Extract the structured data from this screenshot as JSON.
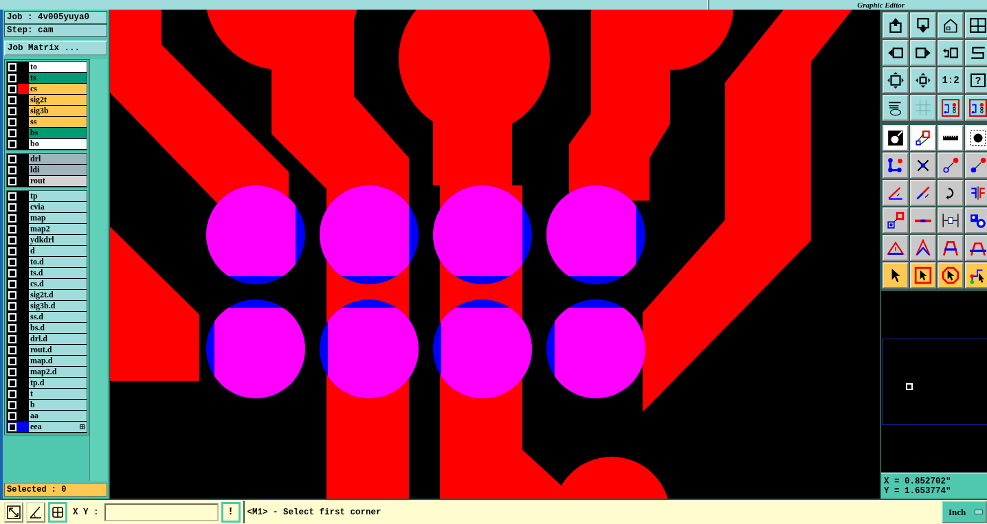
{
  "window": {
    "title": "Graphic Editor"
  },
  "job": {
    "label": "Job : 4v005yuya0",
    "step": "Step: cam",
    "matrix_button": "Job Matrix ..."
  },
  "layer_groups": [
    {
      "layers": [
        {
          "name": "to",
          "color": "#ffffff",
          "selected": false
        },
        {
          "name": "ts",
          "color": "#009a74",
          "selected": false
        },
        {
          "name": "cs",
          "color": "#ffc850",
          "selected": false,
          "swatch": {
            "color": "#ff0000"
          }
        },
        {
          "name": "sig2t",
          "color": "#ffc850",
          "selected": false
        },
        {
          "name": "sig3b",
          "color": "#ffc850",
          "selected": false
        },
        {
          "name": "ss",
          "color": "#ffc850",
          "selected": false
        },
        {
          "name": "bs",
          "color": "#009a74",
          "selected": false
        },
        {
          "name": "bo",
          "color": "#ffffff",
          "selected": false
        }
      ]
    },
    {
      "layers": [
        {
          "name": "drl",
          "color": "#a0b4bc",
          "selected": false
        },
        {
          "name": "ldi",
          "color": "#a0b4bc",
          "selected": false
        },
        {
          "name": "rout",
          "color": "#d4d4d4",
          "selected": false
        }
      ]
    },
    {
      "layers": [
        {
          "name": "tp",
          "color": "#a0dcdc",
          "selected": false
        },
        {
          "name": "cvia",
          "color": "#a0dcdc",
          "selected": false
        },
        {
          "name": "map",
          "color": "#a0dcdc",
          "selected": false
        },
        {
          "name": "map2",
          "color": "#a0dcdc",
          "selected": false
        },
        {
          "name": "ydkdrl",
          "color": "#a0dcdc",
          "selected": false
        },
        {
          "name": "d",
          "color": "#a0dcdc",
          "selected": false
        },
        {
          "name": "to.d",
          "color": "#a0dcdc",
          "selected": false
        },
        {
          "name": "ts.d",
          "color": "#a0dcdc",
          "selected": false
        },
        {
          "name": "cs.d",
          "color": "#a0dcdc",
          "selected": false
        },
        {
          "name": "sig2t.d",
          "color": "#a0dcdc",
          "selected": false
        },
        {
          "name": "sig3b.d",
          "color": "#a0dcdc",
          "selected": false
        },
        {
          "name": "ss.d",
          "color": "#a0dcdc",
          "selected": false
        },
        {
          "name": "bs.d",
          "color": "#a0dcdc",
          "selected": false
        },
        {
          "name": "drl.d",
          "color": "#a0dcdc",
          "selected": false
        },
        {
          "name": "rout.d",
          "color": "#a0dcdc",
          "selected": false
        },
        {
          "name": "map.d",
          "color": "#a0dcdc",
          "selected": false
        },
        {
          "name": "map2.d",
          "color": "#a0dcdc",
          "selected": false
        },
        {
          "name": "tp.d",
          "color": "#a0dcdc",
          "selected": false
        },
        {
          "name": "t",
          "color": "#a0dcdc",
          "selected": false
        },
        {
          "name": "b",
          "color": "#a0dcdc",
          "selected": false
        },
        {
          "name": "aa",
          "color": "#a0dcdc",
          "selected": false
        },
        {
          "name": "eea",
          "color": "#a0dcdc",
          "selected": true,
          "swatch": {
            "color": "#0000ff"
          }
        }
      ]
    }
  ],
  "selected_count": "Selected : 0",
  "toolbar_text_buttons": [
    {
      "label": "1:2"
    },
    {
      "label": "?"
    }
  ],
  "coordinates": {
    "x": "X = 0.852702\"",
    "y": "Y = 1.653774\""
  },
  "bottom_bar": {
    "xy_label": "X Y :",
    "exclaim_button": "!",
    "message": "<M1> - Select first corner",
    "units": "Inch"
  }
}
